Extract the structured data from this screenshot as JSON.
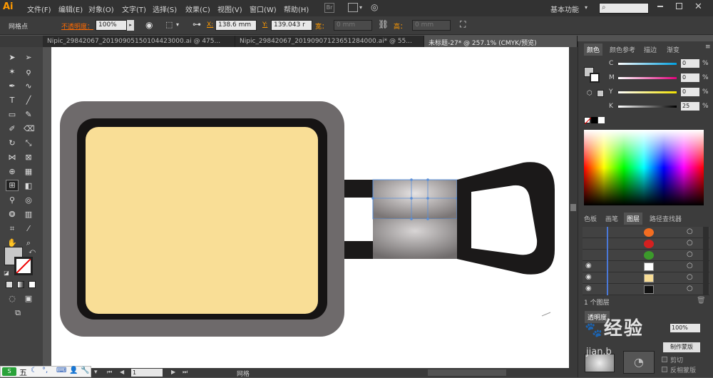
{
  "app": {
    "logo": "Ai"
  },
  "menubar": {
    "items": [
      "文件(F)",
      "编辑(E)",
      "对象(O)",
      "文字(T)",
      "选择(S)",
      "效果(C)",
      "视图(V)",
      "窗口(W)",
      "帮助(H)"
    ],
    "br_label": "Br",
    "workspace": "基本功能",
    "search_placeholder": ""
  },
  "controlbar": {
    "selection_label": "网格点",
    "opacity_label": "不透明度：",
    "opacity_value": "100%",
    "x_label": "X:",
    "x_value": "138.6 mm",
    "y_label": "Y:",
    "y_value": "139.043 r",
    "w_label": "宽：",
    "w_value": "0 mm",
    "h_label": "高：",
    "h_value": "0 mm"
  },
  "tabs": [
    {
      "label": "Nipic_29842067_20190905150104423000.ai @ 475..."
    },
    {
      "label": "Nipic_29842067_20190907123651284000.ai* @ 55..."
    },
    {
      "label": "未标题-27* @ 257.1% (CMYK/预览)"
    }
  ],
  "color_panel": {
    "tabs": [
      "颜色",
      "颜色参考",
      "描边",
      "渐变"
    ],
    "sliders": [
      {
        "label": "C",
        "value": "0",
        "color": "#00a0e0"
      },
      {
        "label": "M",
        "value": "0",
        "color": "#e0007a"
      },
      {
        "label": "Y",
        "value": "0",
        "color": "#f0e000"
      },
      {
        "label": "K",
        "value": "25",
        "color": "#444444"
      }
    ],
    "percent_sign": "%"
  },
  "layers_panel": {
    "tabs": [
      "色板",
      "画笔",
      "图层",
      "路径查找器"
    ],
    "footer": "1 个图层",
    "rows": [
      {
        "thumb_color": "#f26d21",
        "visible": false
      },
      {
        "thumb_color": "#d42020",
        "visible": false
      },
      {
        "thumb_color": "#3c9a2b",
        "visible": false
      },
      {
        "thumb_color": "#ffffff",
        "visible": true
      },
      {
        "thumb_color": "#f9de96",
        "visible": true
      },
      {
        "thumb_color": "#111111",
        "visible": true
      }
    ]
  },
  "transparency_panel": {
    "tab": "透明度",
    "opacity": "100%",
    "make_mask": "制作蒙版",
    "clip": "剪切",
    "invert_mask": "反相蒙版"
  },
  "statusbar": {
    "page_value": "1",
    "mode": "网格"
  },
  "ime": {
    "label": "五"
  },
  "watermark": {
    "text": "经验",
    "sub": "jian.b"
  },
  "colors": {
    "pan_body_outer": "#6e6a6b",
    "pan_body_inner_border": "#161414",
    "pan_fill": "#f9de96",
    "handle_dark": "#1b1919",
    "accent_orange": "#ff9a00"
  }
}
